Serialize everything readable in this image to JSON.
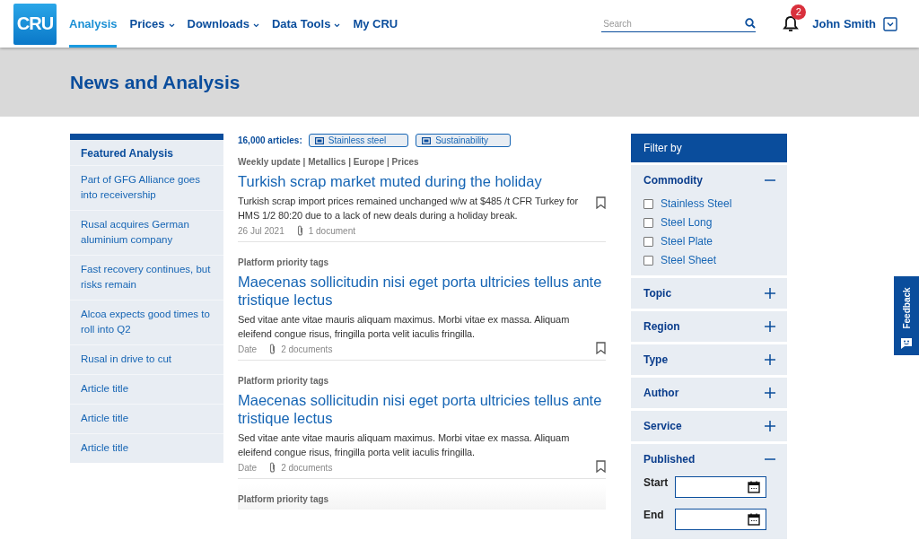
{
  "header": {
    "logo": "CRU",
    "nav": [
      {
        "label": "Analysis",
        "selected": true,
        "dropdown": false
      },
      {
        "label": "Prices",
        "selected": false,
        "dropdown": true
      },
      {
        "label": "Downloads",
        "selected": false,
        "dropdown": true
      },
      {
        "label": "Data Tools",
        "selected": false,
        "dropdown": true
      },
      {
        "label": "My CRU",
        "selected": false,
        "dropdown": false
      }
    ],
    "search": {
      "placeholder": "Search"
    },
    "notifications": {
      "count": "2"
    },
    "user": {
      "name": "John Smith"
    }
  },
  "page_title": "News and Analysis",
  "featured": {
    "title": "Featured Analysis",
    "items": [
      "Part of GFG Alliance goes into receivership",
      "Rusal acquires German aluminium company",
      "Fast recovery continues, but risks remain",
      "Alcoa expects good times to roll into Q2",
      "Rusal in drive to cut",
      "Article title",
      "Article title",
      "Article title"
    ]
  },
  "results": {
    "count": "16,000 articles:",
    "tags": [
      "Stainless steel",
      "Sustainability"
    ]
  },
  "articles": [
    {
      "tags": "Weekly update | Metallics | Europe | Prices",
      "title": "Turkish scrap market muted during the holiday",
      "summary": "Turkish scrap import prices remained unchanged w/w at $485 /t CFR Turkey for HMS 1/2 80:20 due to a lack of new deals during a holiday break.",
      "date": "26 Jul 2021",
      "documents": "1 document"
    },
    {
      "tags": "Platform priority tags",
      "title": "Maecenas sollicitudin nisi eget porta ultricies tellus ante tristique lectus",
      "summary": "Sed vitae ante vitae mauris aliquam maximus. Morbi vitae ex massa. Aliquam eleifend congue risus, fringilla porta velit iaculis fringilla.",
      "date": "Date",
      "documents": "2 documents"
    },
    {
      "tags": "Platform priority tags",
      "title": "Maecenas sollicitudin nisi eget porta ultricies tellus ante tristique lectus",
      "summary": "Sed vitae ante vitae mauris aliquam maximus. Morbi vitae ex massa. Aliquam eleifend congue risus, fringilla porta velit iaculis fringilla.",
      "date": "Date",
      "documents": "2 documents"
    },
    {
      "tags": "Platform priority tags"
    }
  ],
  "filter": {
    "title": "Filter by",
    "sections": [
      {
        "kind": "checklist",
        "label": "Commodity",
        "expanded": true,
        "options": [
          {
            "label": "Stainless Steel",
            "checked": false
          },
          {
            "label": "Steel Long",
            "checked": false
          },
          {
            "label": "Steel Plate",
            "checked": false
          },
          {
            "label": "Steel Sheet",
            "checked": false
          }
        ]
      },
      {
        "kind": "checklist",
        "label": "Topic",
        "expanded": false
      },
      {
        "kind": "checklist",
        "label": "Region",
        "expanded": false
      },
      {
        "kind": "checklist",
        "label": "Type",
        "expanded": false
      },
      {
        "kind": "checklist",
        "label": "Author",
        "expanded": false
      },
      {
        "kind": "checklist",
        "label": "Service",
        "expanded": false
      },
      {
        "kind": "dates",
        "label": "Published",
        "expanded": true,
        "fields": [
          "Start",
          "End"
        ]
      }
    ]
  },
  "feedback": {
    "label": "Feedback"
  }
}
